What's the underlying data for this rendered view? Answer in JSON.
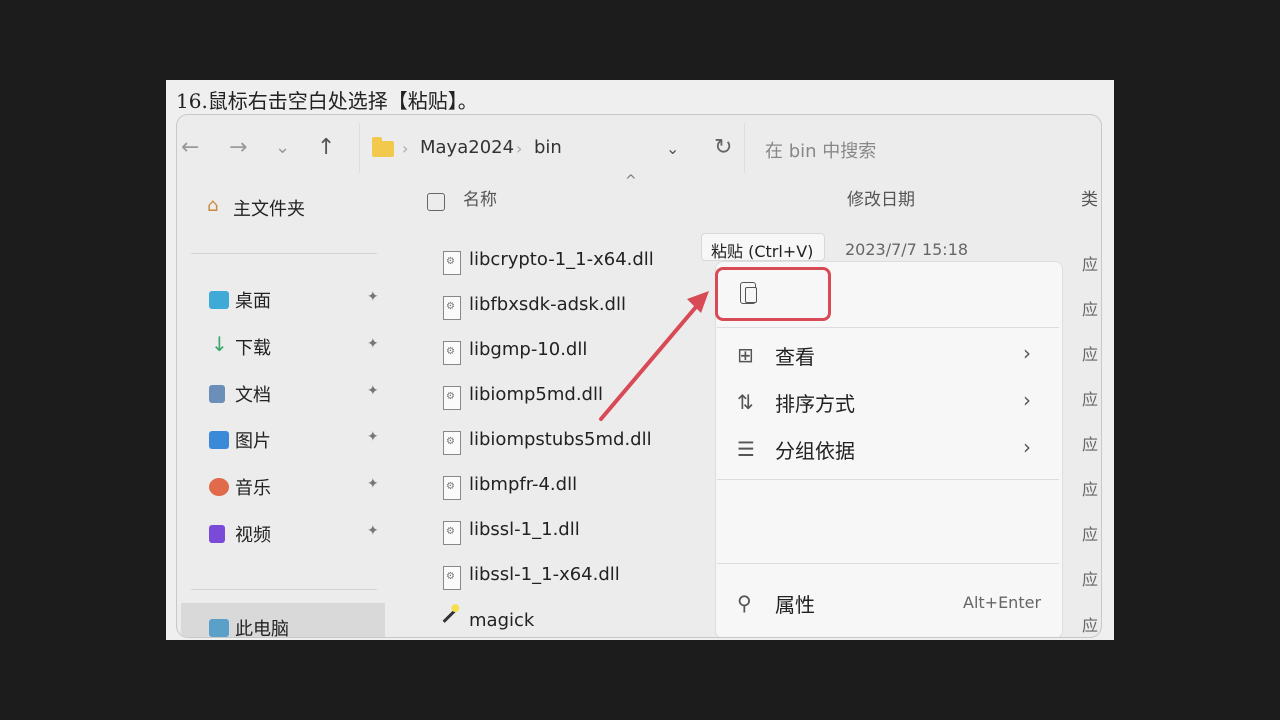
{
  "caption": "16.鼠标右击空白处选择【粘贴】。",
  "toolbar": {
    "back_icon": "←",
    "forward_icon": "→",
    "history_icon": "⌄",
    "up_icon": "↑",
    "breadcrumb": [
      "Maya2024",
      "bin"
    ],
    "refresh_icon": "↻",
    "search_placeholder": "在 bin 中搜索"
  },
  "sidebar": {
    "home_label": "主文件夹",
    "items": [
      {
        "label": "桌面",
        "color": "#3fa9d8"
      },
      {
        "label": "下载",
        "color": "#3aa86b"
      },
      {
        "label": "文档",
        "color": "#6b8fb8"
      },
      {
        "label": "图片",
        "color": "#3a8ad8"
      },
      {
        "label": "音乐",
        "color": "#e06a4a"
      },
      {
        "label": "视频",
        "color": "#7a4ad8"
      }
    ],
    "pin_icon": "📌",
    "this_pc_label": "此电脑"
  },
  "columns": {
    "name": "名称",
    "modified": "修改日期",
    "type": "类"
  },
  "files": [
    "libcrypto-1_1-x64.dll",
    "libfbxsdk-adsk.dll",
    "libgmp-10.dll",
    "libiomp5md.dll",
    "libiompstubs5md.dll",
    "libmpfr-4.dll",
    "libssl-1_1.dll",
    "libssl-1_1-x64.dll",
    "magick"
  ],
  "date_partial": "2023/7/7 15:18",
  "type_cell": "应",
  "context_menu": {
    "tooltip": "粘贴 (Ctrl+V)",
    "items": [
      {
        "label": "查看",
        "icon": "⊞"
      },
      {
        "label": "排序方式",
        "icon": "⇅"
      },
      {
        "label": "分组依据",
        "icon": "☰"
      }
    ],
    "properties": {
      "label": "属性",
      "shortcut": "Alt+Enter",
      "icon": "🔧"
    },
    "chevron": "›"
  },
  "colors": {
    "highlight": "#d84a55",
    "arrow": "#d84a55"
  }
}
